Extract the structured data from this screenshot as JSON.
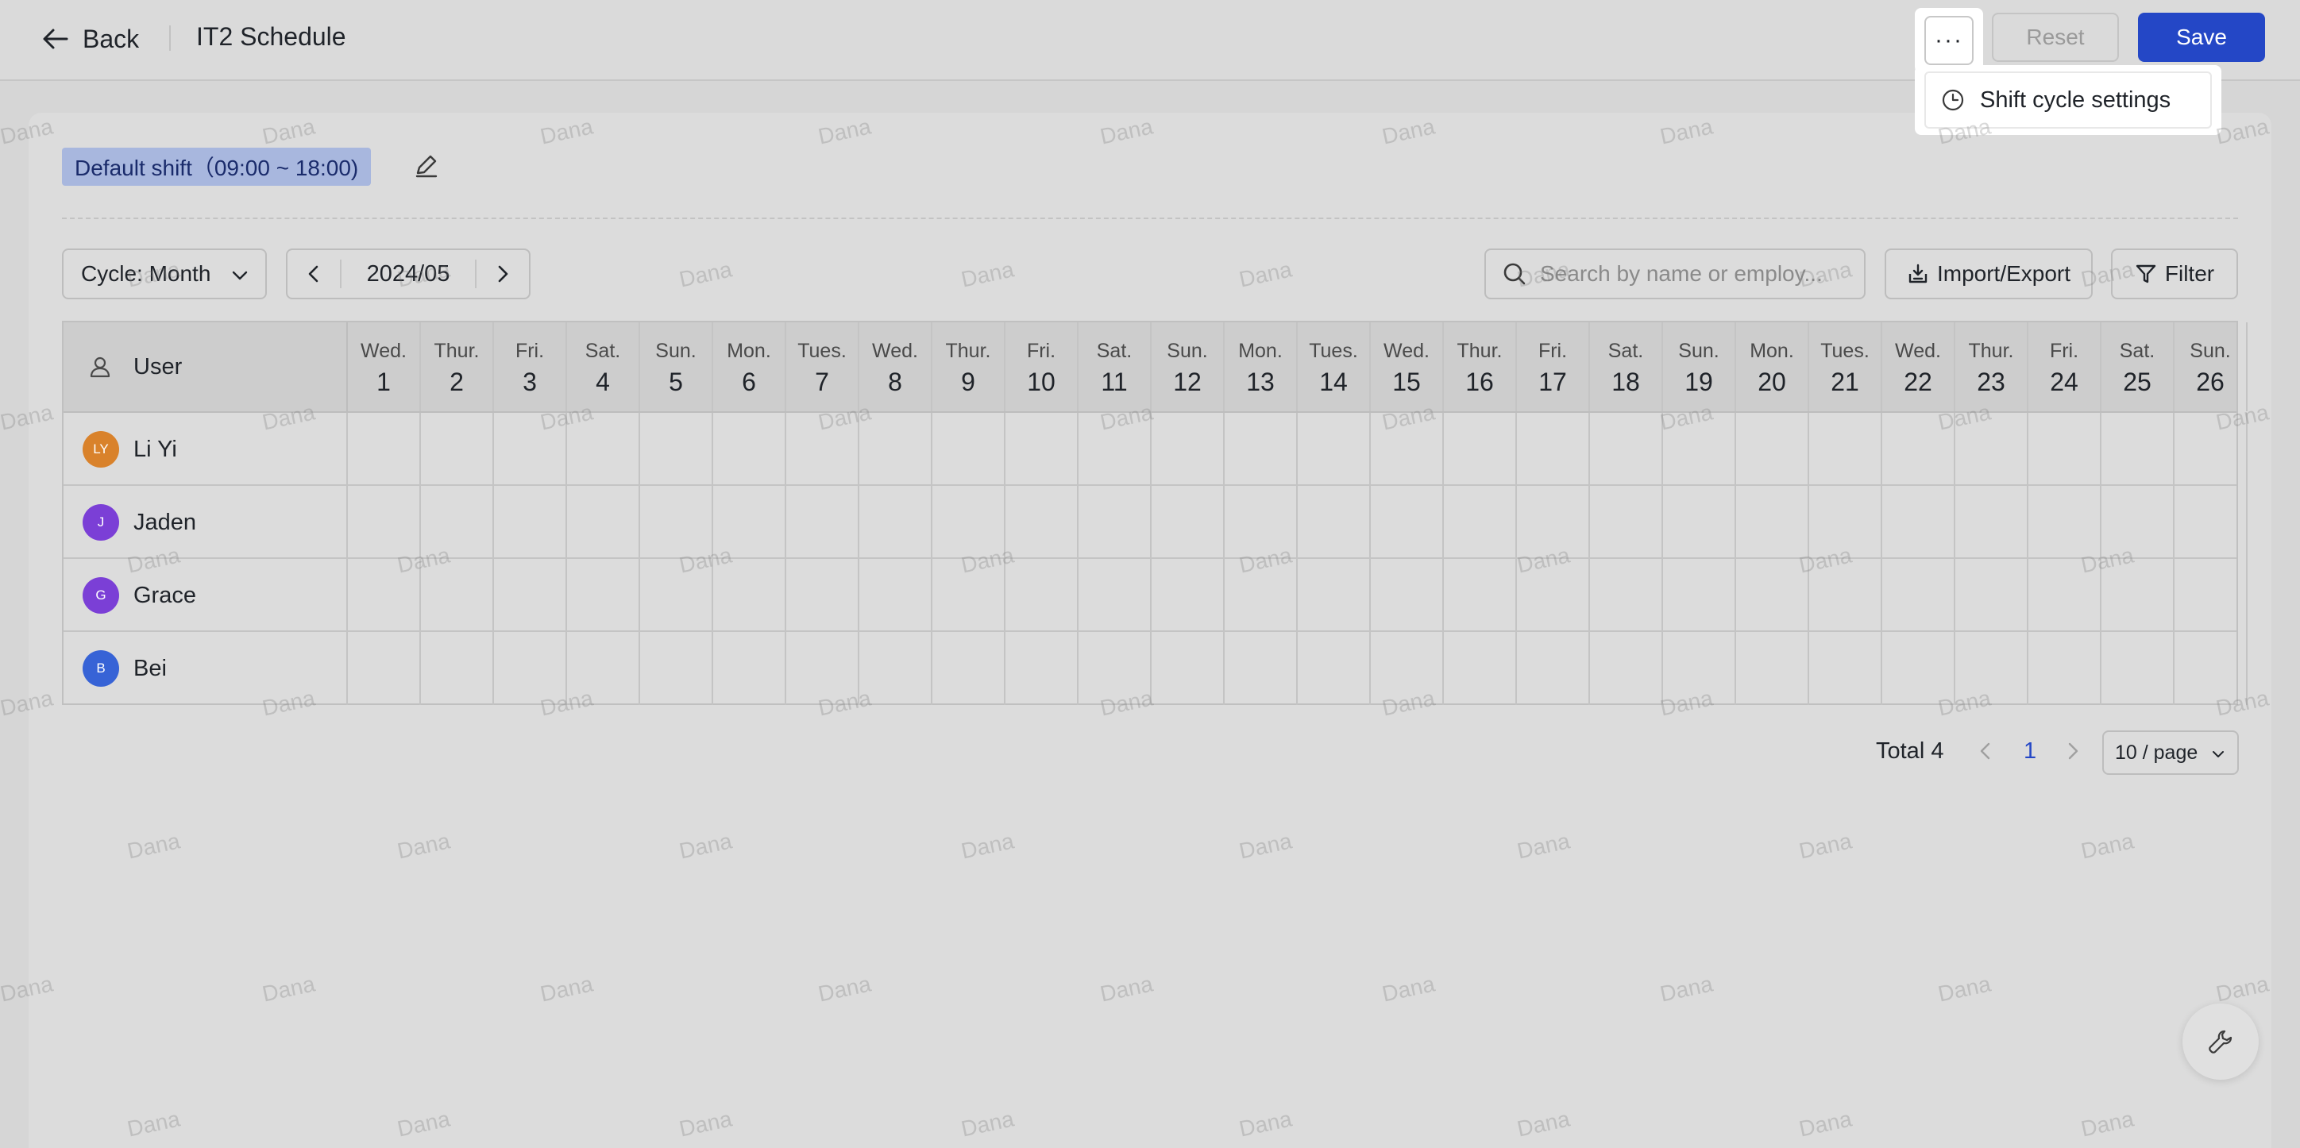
{
  "header": {
    "back_label": "Back",
    "title": "IT2 Schedule",
    "more_label": "···",
    "reset_label": "Reset",
    "save_label": "Save"
  },
  "menu": {
    "items": [
      {
        "label": "Shift cycle settings",
        "icon": "clock-icon"
      }
    ]
  },
  "shift": {
    "label": "Default shift（09:00 ~ 18:00)"
  },
  "toolbar": {
    "cycle_label": "Cycle: Month",
    "date": "2024/05",
    "search_placeholder": "Search by name or employ...",
    "import_label": "Import/Export",
    "filter_label": "Filter"
  },
  "table": {
    "user_header": "User",
    "days": [
      {
        "wd": "Wed.",
        "d": "1"
      },
      {
        "wd": "Thur.",
        "d": "2"
      },
      {
        "wd": "Fri.",
        "d": "3"
      },
      {
        "wd": "Sat.",
        "d": "4"
      },
      {
        "wd": "Sun.",
        "d": "5"
      },
      {
        "wd": "Mon.",
        "d": "6"
      },
      {
        "wd": "Tues.",
        "d": "7"
      },
      {
        "wd": "Wed.",
        "d": "8"
      },
      {
        "wd": "Thur.",
        "d": "9"
      },
      {
        "wd": "Fri.",
        "d": "10"
      },
      {
        "wd": "Sat.",
        "d": "11"
      },
      {
        "wd": "Sun.",
        "d": "12"
      },
      {
        "wd": "Mon.",
        "d": "13"
      },
      {
        "wd": "Tues.",
        "d": "14"
      },
      {
        "wd": "Wed.",
        "d": "15"
      },
      {
        "wd": "Thur.",
        "d": "16"
      },
      {
        "wd": "Fri.",
        "d": "17"
      },
      {
        "wd": "Sat.",
        "d": "18"
      },
      {
        "wd": "Sun.",
        "d": "19"
      },
      {
        "wd": "Mon.",
        "d": "20"
      },
      {
        "wd": "Tues.",
        "d": "21"
      },
      {
        "wd": "Wed.",
        "d": "22"
      },
      {
        "wd": "Thur.",
        "d": "23"
      },
      {
        "wd": "Fri.",
        "d": "24"
      },
      {
        "wd": "Sat.",
        "d": "25"
      },
      {
        "wd": "Sun.",
        "d": "26"
      }
    ],
    "users": [
      {
        "name": "Li Yi",
        "initials": "LY",
        "color": "#d9822b"
      },
      {
        "name": "Jaden",
        "initials": "J",
        "color": "#7b3fd6"
      },
      {
        "name": "Grace",
        "initials": "G",
        "color": "#7b3fd6"
      },
      {
        "name": "Bei",
        "initials": "B",
        "color": "#3763d6"
      }
    ]
  },
  "pagination": {
    "total_label": "Total 4",
    "current_page": "1",
    "page_size_label": "10 / page"
  },
  "watermark_text": "Dana",
  "colors": {
    "accent": "#2447c6",
    "shift_tag_bg": "#a8b7de"
  }
}
